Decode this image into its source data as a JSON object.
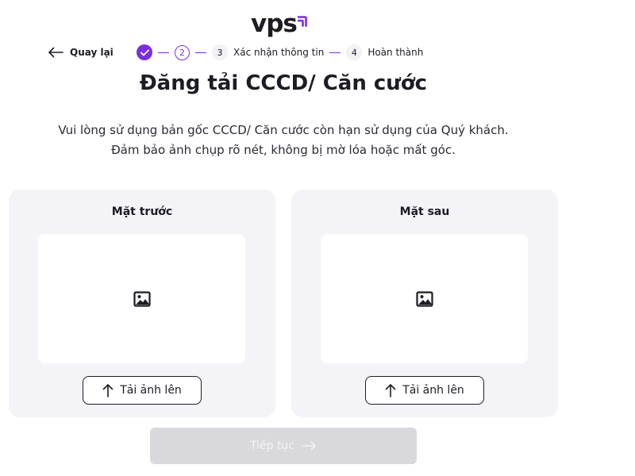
{
  "logo": {
    "text": "vps"
  },
  "header": {
    "back_label": "Quay lại"
  },
  "stepper": {
    "current_step": "2",
    "steps": [
      {
        "number": "3",
        "label": "Xác nhận thông tin"
      },
      {
        "number": "4",
        "label": "Hoàn thành"
      }
    ]
  },
  "main": {
    "title": "Đăng tải CCCD/ Căn cước",
    "description_line1": "Vui lòng sử dụng bản gốc CCCD/ Căn cước còn hạn sử dụng của Quý khách.",
    "description_line2": "Đảm bảo ảnh chụp rõ nét, không bị mờ lóa hoặc mất góc."
  },
  "cards": [
    {
      "title": "Mặt trước",
      "upload_label": "Tải ảnh lên"
    },
    {
      "title": "Mặt sau",
      "upload_label": "Tải ảnh lên"
    }
  ],
  "footer": {
    "continue_label": "Tiếp tục"
  },
  "colors": {
    "accent": "#7a2ee0",
    "text": "#1c1c24",
    "card_bg": "#f4f4f8",
    "disabled_button": "#d9d9dd"
  }
}
